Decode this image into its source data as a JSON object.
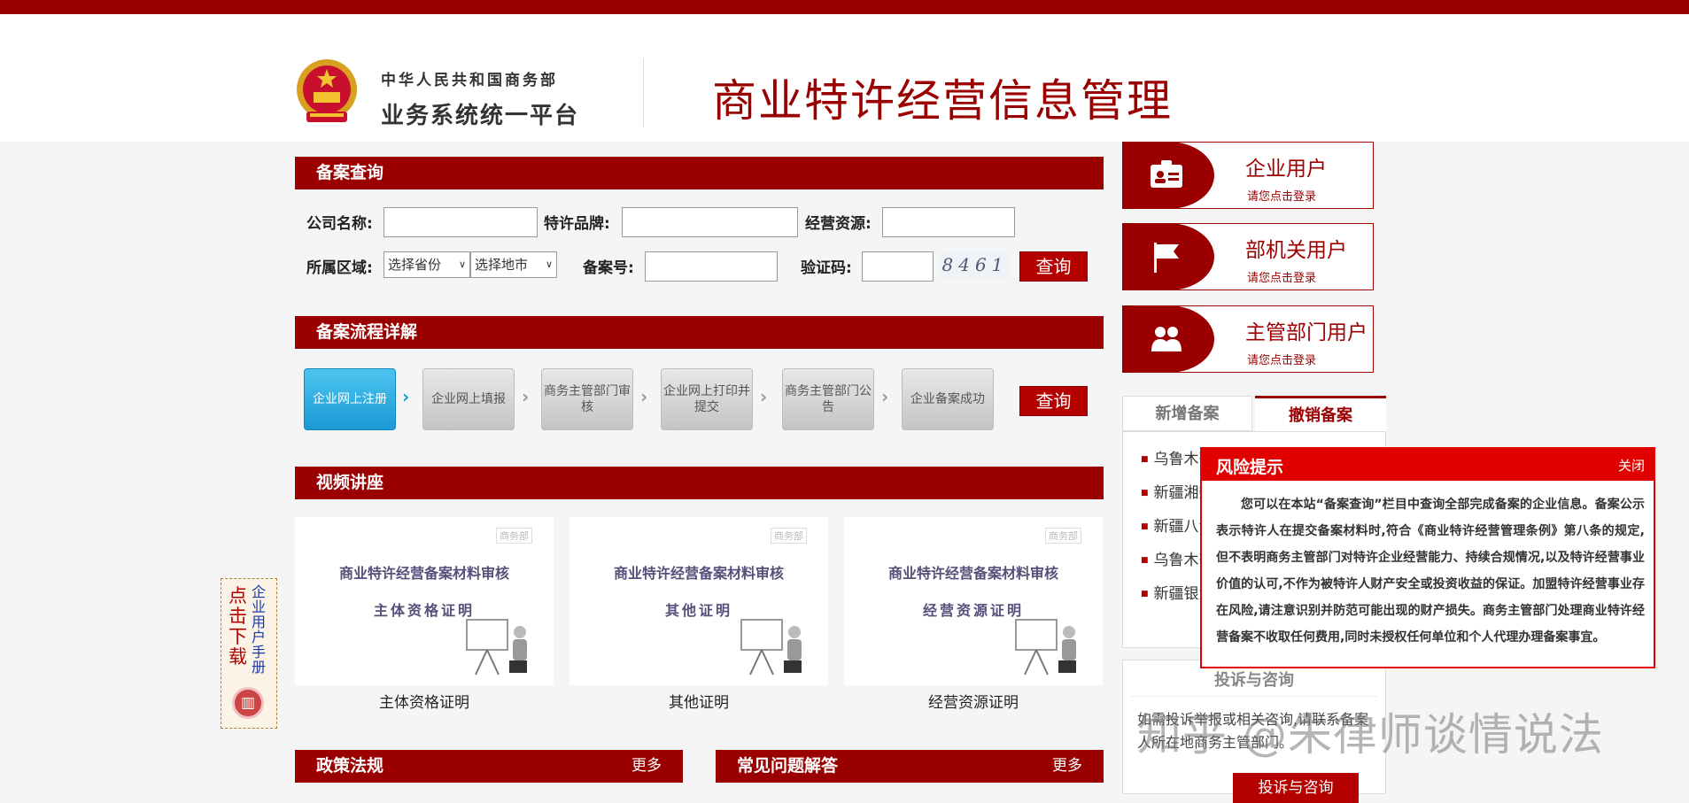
{
  "header": {
    "ministry": "中华人民共和国商务部",
    "platform": "业务系统统一平台",
    "site_title": "商业特许经营信息管理"
  },
  "query": {
    "section_title": "备案查询",
    "company_label": "公司名称:",
    "brand_label": "特许品牌:",
    "resource_label": "经营资源:",
    "region_label": "所属区域:",
    "province_select": "选择省份",
    "city_select": "选择地市",
    "record_no_label": "备案号:",
    "captcha_label": "验证码:",
    "captcha_value": "8461",
    "search_button": "查询"
  },
  "process": {
    "section_title": "备案流程详解",
    "steps": [
      "企业网上注册",
      "企业网上填报",
      "商务主管部门审核",
      "企业网上打印并提交",
      "商务主管部门公告",
      "企业备案成功"
    ],
    "search_button": "查询"
  },
  "videos": {
    "section_title": "视频讲座",
    "heading": "商业特许经营备案材料审核",
    "logo_text": "商务部",
    "items": [
      {
        "subtitle": "主体资格证明",
        "caption": "主体资格证明"
      },
      {
        "subtitle": "其他证明",
        "caption": "其他证明"
      },
      {
        "subtitle": "经营资源证明",
        "caption": "经营资源证明"
      }
    ]
  },
  "manual": {
    "line1": "点击下载",
    "line2": "企业用户手册"
  },
  "users": [
    {
      "name": "企业用户",
      "hint": "请您点击登录",
      "icon": "id-card-icon"
    },
    {
      "name": "部机关用户",
      "hint": "请您点击登录",
      "icon": "flag-icon"
    },
    {
      "name": "主管部门用户",
      "hint": "请您点击登录",
      "icon": "users-icon"
    }
  ],
  "tabs": {
    "new_records": "新增备案",
    "revoked_records": "撤销备案"
  },
  "revoked_list": [
    "乌鲁木齐",
    "新疆湘魏",
    "新疆八音",
    "乌鲁木齐",
    "新疆银免"
  ],
  "complaint": {
    "title": "投诉与咨询",
    "text": "如需投诉举报或相关咨询,请联系备案人所在地商务主管部门。",
    "button": "投诉与咨询"
  },
  "policy": {
    "title": "政策法规",
    "more": "更多"
  },
  "faq": {
    "title": "常见问题解答",
    "more": "更多"
  },
  "risk_popup": {
    "title": "风险提示",
    "close": "关闭",
    "body": "您可以在本站“备案查询”栏目中查询全部完成备案的企业信息。备案公示表示特许人在提交备案材料时,符合《商业特许经营管理条例》第八条的规定,但不表明商务主管部门对特许企业经营能力、持续合规情况,以及特许经营事业价值的认可,不作为被特许人财产安全或投资收益的保证。加盟特许经营事业存在风险,请注意识别并防范可能出现的财产损失。商务主管部门处理商业特许经营备案不收取任何费用,同时未授权任何单位和个人代理办理备案事宜。"
  },
  "watermark": "知乎 @朱律师谈情说法",
  "colors": {
    "brand_red": "#9b0000",
    "button_red": "#b50000",
    "popup_red": "#e00000",
    "step_active": "#1c9ad6"
  }
}
